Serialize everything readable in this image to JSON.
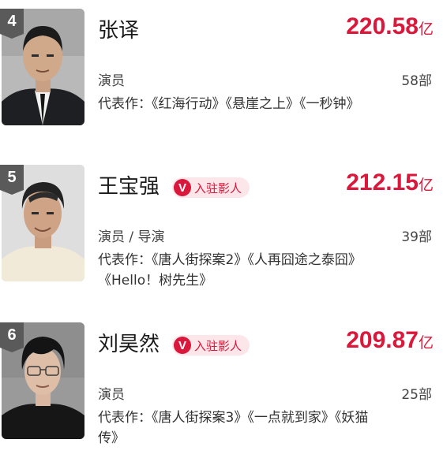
{
  "badge_label": "入驻影人",
  "badge_icon": "V",
  "people": [
    {
      "rank": "4",
      "name": "张译",
      "box_office": "220.58",
      "box_unit": "亿",
      "role": "演员",
      "film_count": "58部",
      "works": "代表作：《红海行动》《悬崖之上》《一秒钟》",
      "verified": false
    },
    {
      "rank": "5",
      "name": "王宝强",
      "box_office": "212.15",
      "box_unit": "亿",
      "role": "演员 / 导演",
      "film_count": "39部",
      "works": "代表作：《唐人街探案2》《人再囧途之泰囧》《Hello！树先生》",
      "verified": true
    },
    {
      "rank": "6",
      "name": "刘昊然",
      "box_office": "209.87",
      "box_unit": "亿",
      "role": "演员",
      "film_count": "25部",
      "works": "代表作：《唐人街探案3》《一点就到家》《妖猫传》",
      "verified": true
    }
  ],
  "colors": {
    "accent": "#d9183b",
    "badge_bg": "#fde6ea",
    "rank_tag": "#5a5a5a"
  }
}
